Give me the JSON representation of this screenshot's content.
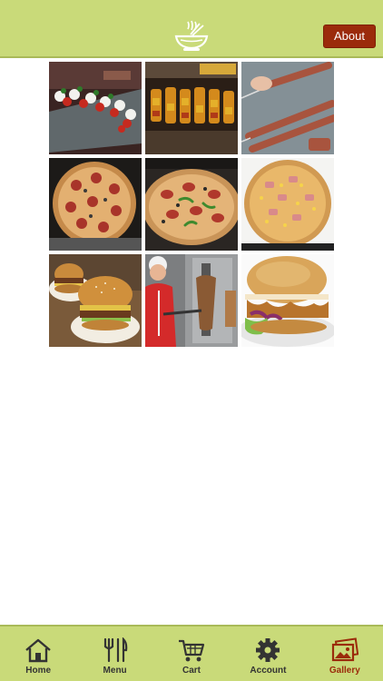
{
  "header": {
    "logo_icon": "noodle-bowl-icon",
    "about_label": "About"
  },
  "gallery": {
    "photos": [
      {
        "name": "caprese-skewers-photo"
      },
      {
        "name": "chicken-kebab-skewers-photo"
      },
      {
        "name": "kofta-kebab-skewers-photo"
      },
      {
        "name": "pepperoni-pizza-photo"
      },
      {
        "name": "pepperoni-pepper-pizza-photo"
      },
      {
        "name": "ham-corn-pizza-photo"
      },
      {
        "name": "two-burgers-photo"
      },
      {
        "name": "chef-doner-photo"
      },
      {
        "name": "chicken-burger-photo"
      }
    ]
  },
  "tabbar": {
    "items": [
      {
        "label": "Home",
        "icon": "home-icon"
      },
      {
        "label": "Menu",
        "icon": "cutlery-icon"
      },
      {
        "label": "Cart",
        "icon": "cart-icon"
      },
      {
        "label": "Account",
        "icon": "gear-icon"
      },
      {
        "label": "Gallery",
        "icon": "gallery-icon"
      }
    ],
    "active": "Gallery"
  },
  "colors": {
    "bar": "#c9da79",
    "accent": "#9b2b0b",
    "icon": "#333333"
  }
}
